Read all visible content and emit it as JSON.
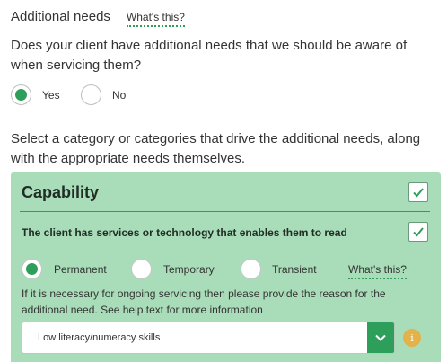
{
  "section": {
    "heading": "Additional needs",
    "whats_this": "What's this?",
    "question": "Does your client have additional needs that we should be aware of when servicing them?",
    "options": [
      {
        "label": "Yes",
        "selected": true
      },
      {
        "label": "No",
        "selected": false
      }
    ],
    "instructions": "Select a category or categories that drive the additional needs, along with the appropriate needs themselves."
  },
  "panel": {
    "title": "Capability",
    "title_checked": true,
    "need_label": "The client has services or technology that enables them to read",
    "need_checked": true,
    "durations": [
      {
        "label": "Permanent",
        "selected": true
      },
      {
        "label": "Temporary",
        "selected": false
      },
      {
        "label": "Transient",
        "selected": false
      }
    ],
    "whats_this": "What's this?",
    "reason_text": "If it is necessary for ongoing servicing then please provide the reason for the additional need. See help text for more information",
    "reason_select": {
      "value": "Low literacy/numeracy skills"
    },
    "info_icon": "info-icon"
  },
  "colors": {
    "accent": "#2e9e5b",
    "panel_bg": "#a9dcb8",
    "info": "#e3b24a"
  }
}
